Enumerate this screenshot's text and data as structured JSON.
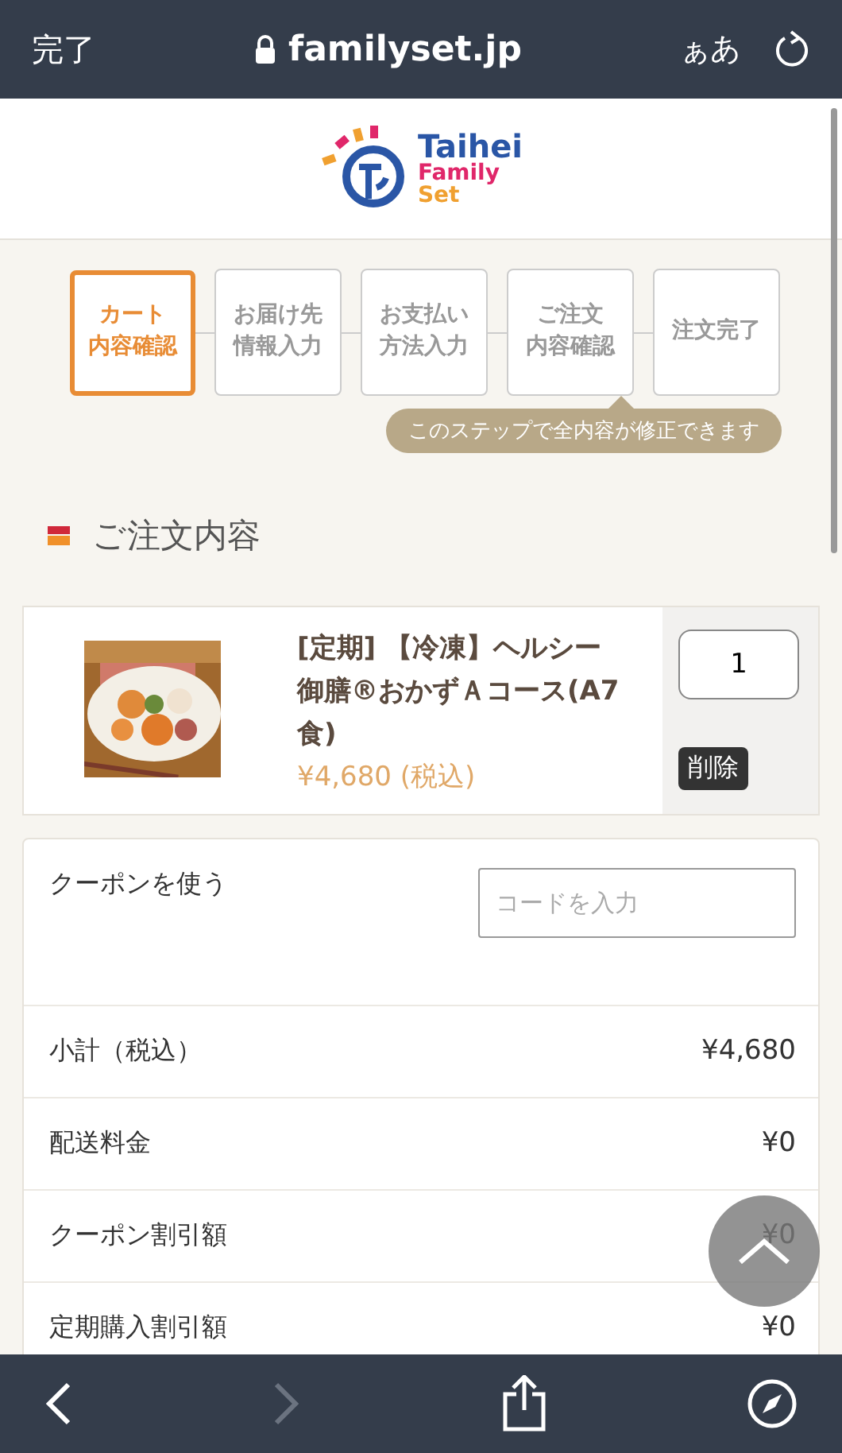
{
  "browser_bar": {
    "done": "完了",
    "url": "familyset.jp",
    "text_size": "ぁあ"
  },
  "logo": {
    "line1": "Taihei",
    "line2": "Family",
    "line3": "Set"
  },
  "steps": [
    {
      "lines": [
        "カート",
        "内容確認"
      ],
      "selected": true
    },
    {
      "lines": [
        "お届け先",
        "情報入力"
      ],
      "selected": false
    },
    {
      "lines": [
        "お支払い",
        "方法入力"
      ],
      "selected": false
    },
    {
      "lines": [
        "ご注文",
        "内容確認"
      ],
      "selected": false
    },
    {
      "lines": [
        "注文完了"
      ],
      "selected": false
    }
  ],
  "step_tooltip": "このステップで全内容が修正できます",
  "section_title": "ご注文内容",
  "cart_item": {
    "name": "[定期] 【冷凍】ヘルシー御膳®おかずＡコース(A7食)",
    "price": "¥4,680 (税込)",
    "quantity": "1",
    "delete": "削除"
  },
  "coupon": {
    "label": "クーポンを使う",
    "placeholder": "コードを入力"
  },
  "summary": [
    {
      "label": "小計（税込）",
      "value": "¥4,680"
    },
    {
      "label": "配送料金",
      "value": "¥0"
    },
    {
      "label": "クーポン割引額",
      "value": "¥0"
    },
    {
      "label": "定期購入割引額",
      "value": "¥0"
    }
  ],
  "toolbar": {
    "back_disabled": false,
    "forward_disabled": true
  }
}
